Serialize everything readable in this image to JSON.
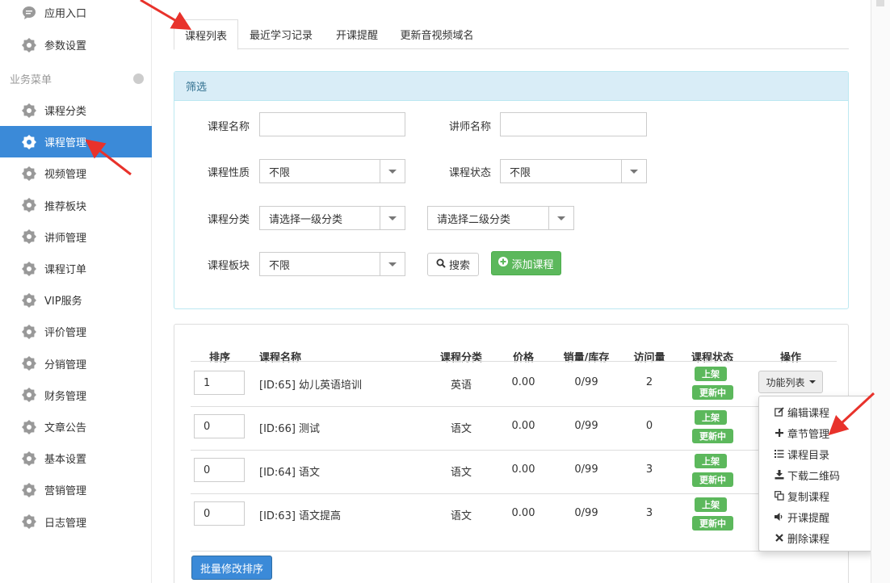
{
  "sidebar": {
    "top_items": [
      {
        "label": "应用入口",
        "icon": "comment-icon"
      },
      {
        "label": "参数设置",
        "icon": "gear-icon"
      }
    ],
    "section_title": "业务菜单",
    "items": [
      {
        "label": "课程分类"
      },
      {
        "label": "课程管理",
        "active": true
      },
      {
        "label": "视频管理"
      },
      {
        "label": "推荐板块"
      },
      {
        "label": "讲师管理"
      },
      {
        "label": "课程订单"
      },
      {
        "label": "VIP服务"
      },
      {
        "label": "评价管理"
      },
      {
        "label": "分销管理"
      },
      {
        "label": "财务管理"
      },
      {
        "label": "文章公告"
      },
      {
        "label": "基本设置"
      },
      {
        "label": "营销管理"
      },
      {
        "label": "日志管理"
      }
    ]
  },
  "tabs": [
    {
      "label": "课程列表",
      "active": true
    },
    {
      "label": "最近学习记录"
    },
    {
      "label": "开课提醒"
    },
    {
      "label": "更新音视频域名"
    }
  ],
  "filter": {
    "title": "筛选",
    "course_name_label": "课程名称",
    "course_name_value": "",
    "lecturer_name_label": "讲师名称",
    "lecturer_name_value": "",
    "nature_label": "课程性质",
    "nature_value": "不限",
    "status_label": "课程状态",
    "status_value": "不限",
    "category_label": "课程分类",
    "category_1_value": "请选择一级分类",
    "category_2_value": "请选择二级分类",
    "block_label": "课程板块",
    "block_value": "不限",
    "search_label": "搜索",
    "add_label": "添加课程"
  },
  "table": {
    "headers": {
      "sort": "排序",
      "name": "课程名称",
      "category": "课程分类",
      "price": "价格",
      "sales": "销量/库存",
      "visits": "访问量",
      "status": "课程状态",
      "ops": "操作"
    },
    "rows": [
      {
        "sort": "1",
        "name": "[ID:65] 幼儿英语培训",
        "category": "英语",
        "price": "0.00",
        "sales": "0/99",
        "visits": "2",
        "status1": "上架",
        "status2": "更新中"
      },
      {
        "sort": "0",
        "name": "[ID:66] 测试",
        "category": "语文",
        "price": "0.00",
        "sales": "0/99",
        "visits": "0",
        "status1": "上架",
        "status2": "更新中"
      },
      {
        "sort": "0",
        "name": "[ID:64] 语文",
        "category": "语文",
        "price": "0.00",
        "sales": "0/99",
        "visits": "3",
        "status1": "上架",
        "status2": "更新中"
      },
      {
        "sort": "0",
        "name": "[ID:63] 语文提高",
        "category": "语文",
        "price": "0.00",
        "sales": "0/99",
        "visits": "3",
        "status1": "上架",
        "status2": "更新中"
      }
    ],
    "func_button": "功能列表",
    "batch_button": "批量修改排序"
  },
  "menu": [
    {
      "label": "编辑课程",
      "icon": "edit-icon"
    },
    {
      "label": "章节管理",
      "icon": "plus-icon"
    },
    {
      "label": "课程目录",
      "icon": "list-icon"
    },
    {
      "label": "下载二维码",
      "icon": "download-icon"
    },
    {
      "label": "复制课程",
      "icon": "copy-icon"
    },
    {
      "label": "开课提醒",
      "icon": "volume-icon"
    },
    {
      "label": "删除课程",
      "icon": "close-icon"
    }
  ],
  "colors": {
    "primary": "#3b8ad8",
    "success": "#5cb85c",
    "panel_head": "#d9edf7",
    "annotation_arrow": "#e8322b"
  }
}
